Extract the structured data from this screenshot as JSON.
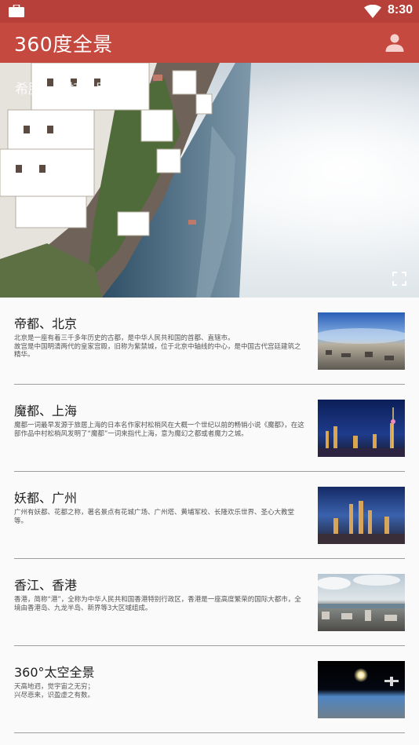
{
  "status_bar": {
    "time": "8:30",
    "icons": [
      "briefcase-icon",
      "wifi-icon"
    ]
  },
  "app_bar": {
    "title": "360度全景",
    "action_icon": "account-icon"
  },
  "hero": {
    "caption": "希腊、圣托里尼岛",
    "action_icon": "fullscreen-icon"
  },
  "items": [
    {
      "name": "帝都、北京",
      "desc": "北京是一座有着三千多年历史的古都，是中华人民共和国的首都、直辖市。\n故宫是中国明清两代的皇家宫殿，旧称为紫禁城，位于北京中轴线的中心，是中国古代宫廷建筑之精华。"
    },
    {
      "name": "魔都、上海",
      "desc": "魔都一词最早发源于旅居上海的日本名作家村松梢风在大概一个世纪以前的畅销小说《魔都》，在这部作品中村松梢风发明了“魔都”一词来指代上海，意为魔幻之都或者魔力之城。"
    },
    {
      "name": "妖都、广州",
      "desc": "广州有妖都、花都之称，著名景点有花城广场、广州塔、黄埔军校、长隆欢乐世界、圣心大教堂等。"
    },
    {
      "name": "香江、香港",
      "desc": "香港，简称“港”，全称为中华人民共和国香港特别行政区，香港是一座高度繁荣的国际大都市，全境由香港岛、九龙半岛、新界等3大区域组成。"
    },
    {
      "name": "360°太空全景",
      "desc": "天高地迥，觉宇宙之无穷；\n兴尽悲来，识盈虚之有数。"
    }
  ]
}
